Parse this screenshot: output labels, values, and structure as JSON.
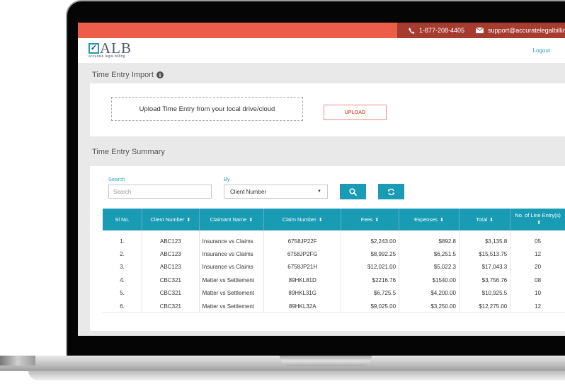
{
  "topbar": {
    "phone": "1-877-208-4405",
    "email": "support@accuratelegalbilling",
    "phone_icon": "phone-icon",
    "email_icon": "envelope-icon",
    "colors": {
      "bar": "#ec5d4a",
      "contact_bg": "#a63c30"
    }
  },
  "header": {
    "logo_text": "ALB",
    "logo_tagline": "accurate legal billing",
    "logout_label": "Logout"
  },
  "import_section": {
    "title": "Time Entry Import",
    "info_icon": "info-circle-icon",
    "dropzone_text": "Upload Time Entry from your local drive/cloud",
    "upload_label": "UPLOAD"
  },
  "summary_section": {
    "title": "Time Entry Summary",
    "search_label": "Search",
    "search_placeholder": "Search",
    "search_value": "",
    "by_label": "By",
    "by_selected": "Client Number",
    "search_button_icon": "search-icon",
    "refresh_button_icon": "refresh-icon",
    "accent_color": "#1a9bb4",
    "columns": [
      {
        "label": "Sl No.",
        "sortable": false
      },
      {
        "label": "Client Number",
        "sortable": true
      },
      {
        "label": "Claimant Name",
        "sortable": true
      },
      {
        "label": "Claim Number",
        "sortable": true
      },
      {
        "label": "Fees",
        "sortable": true
      },
      {
        "label": "Expenses",
        "sortable": true
      },
      {
        "label": "Total",
        "sortable": true
      },
      {
        "label": "No. of Line Entry(s)",
        "sortable": true
      }
    ],
    "rows": [
      {
        "sl": "1.",
        "client": "ABC123",
        "claimant": "Insurance vs Claims",
        "claim": "6758JP22F",
        "fees": "$2,243.00",
        "expenses": "$892.8",
        "total": "$3,135.8",
        "entries": "05"
      },
      {
        "sl": "2.",
        "client": "ABC123",
        "claimant": "Insurance vs Claims",
        "claim": "6758JP2FG",
        "fees": "$8,992.25",
        "expenses": "$6,251.5",
        "total": "$15,513.75",
        "entries": "12"
      },
      {
        "sl": "3.",
        "client": "ABC123",
        "claimant": "Insurance vs Claims",
        "claim": "6758JP21H",
        "fees": "$12,021.00",
        "expenses": "$5,022.3",
        "total": "$17,043.3",
        "entries": "20"
      },
      {
        "sl": "4.",
        "client": "CBC321",
        "claimant": "Matter vs Settlement",
        "claim": "89HKL81D",
        "fees": "$2216.76",
        "expenses": "$1540.00",
        "total": "$3,756.76",
        "entries": "08"
      },
      {
        "sl": "5.",
        "client": "CBC321",
        "claimant": "Matter vs Settlement",
        "claim": "89HKL31G",
        "fees": "$6,725.5",
        "expenses": "$4,200.00",
        "total": "$10,925.5",
        "entries": "10"
      },
      {
        "sl": "6.",
        "client": "CBC321",
        "claimant": "Matter vs Settlement",
        "claim": "89HKL32A",
        "fees": "$9,025.00",
        "expenses": "$3,250.00",
        "total": "$12,275.00",
        "entries": "12"
      }
    ]
  }
}
